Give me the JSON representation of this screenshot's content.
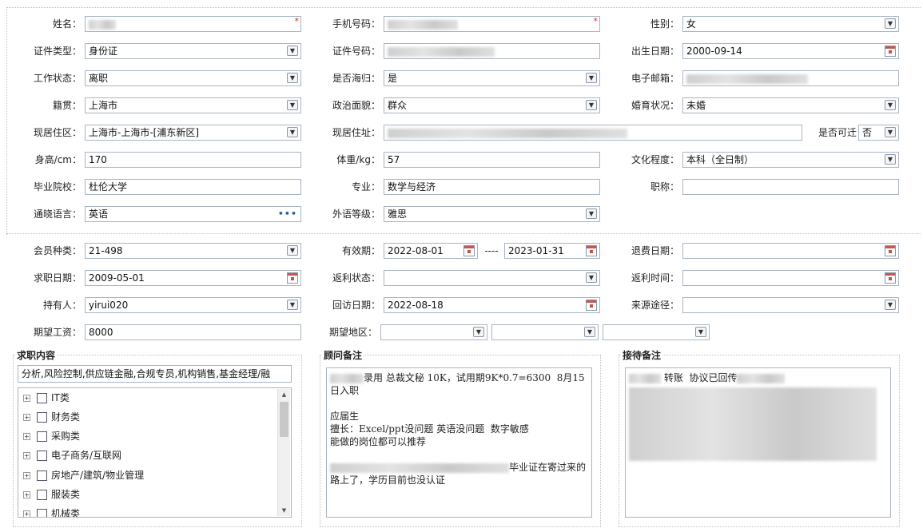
{
  "form": {
    "name_label": "姓名：",
    "mobile_label": "手机号码：",
    "gender_label": "性别：",
    "gender_value": "女",
    "id_type_label": "证件类型：",
    "id_type_value": "身份证",
    "id_no_label": "证件号码：",
    "birth_label": "出生日期：",
    "birth_value": "2000-09-14",
    "work_status_label": "工作状态：",
    "work_status_value": "离职",
    "returnee_label": "是否海归：",
    "returnee_value": "是",
    "email_label": "电子邮箱：",
    "native_label": "籍贯：",
    "native_value": "上海市",
    "political_label": "政治面貌：",
    "political_value": "群众",
    "marital_label": "婚育状况：",
    "marital_value": "未婚",
    "district_label": "现居住区：",
    "district_value": "上海市-上海市-[浦东新区]",
    "address_label": "现居住址：",
    "relocate_label": "是否可迁",
    "relocate_value": "否",
    "height_label": "身高/cm：",
    "height_value": "170",
    "weight_label": "体重/kg：",
    "weight_value": "57",
    "education_label": "文化程度：",
    "education_value": "本科（全日制）",
    "school_label": "毕业院校：",
    "school_value": "杜伦大学",
    "major_label": "专业：",
    "major_value": "数学与经济",
    "title_label": "职称：",
    "language_label": "通晓语言：",
    "language_value": "英语",
    "language_level_label": "外语等级：",
    "language_level_value": "雅思"
  },
  "member": {
    "type_label": "会员种类：",
    "type_value": "21-498",
    "valid_label": "有效期：",
    "valid_from": "2022-08-01",
    "valid_sep": "----",
    "valid_to": "2023-01-31",
    "refund_label": "退费日期：",
    "apply_label": "求职日期：",
    "apply_value": "2009-05-01",
    "rebate_status_label": "返利状态：",
    "rebate_time_label": "返利时间：",
    "holder_label": "持有人：",
    "holder_value": "yirui020",
    "visit_label": "回访日期：",
    "visit_value": "2022-08-18",
    "source_label": "来源途径：",
    "salary_label": "期望工资：",
    "salary_value": "8000",
    "region_label": "期望地区："
  },
  "job": {
    "legend": "求职内容",
    "summary": "分析,风险控制,供应链金融,合规专员,机构销售,基金经理/融",
    "items": [
      "IT类",
      "财务类",
      "采购类",
      "电子商务/互联网",
      "房地产/建筑/物业管理",
      "服装类",
      "机械类"
    ]
  },
  "advisor": {
    "legend": "顾问备注",
    "line1": "录用 总裁文秘 10K，试用期9K*0.7=6300  8月15日入职",
    "line2": "应届生",
    "line3": "擅长：Excel/ppt没问题 英语没问题  数字敏感",
    "line4": "能做的岗位都可以推荐",
    "line5": "毕业证在寄过来的路上了，学历目前也没认证"
  },
  "reception": {
    "legend": "接待备注",
    "line1": "转账  协议已回传"
  }
}
